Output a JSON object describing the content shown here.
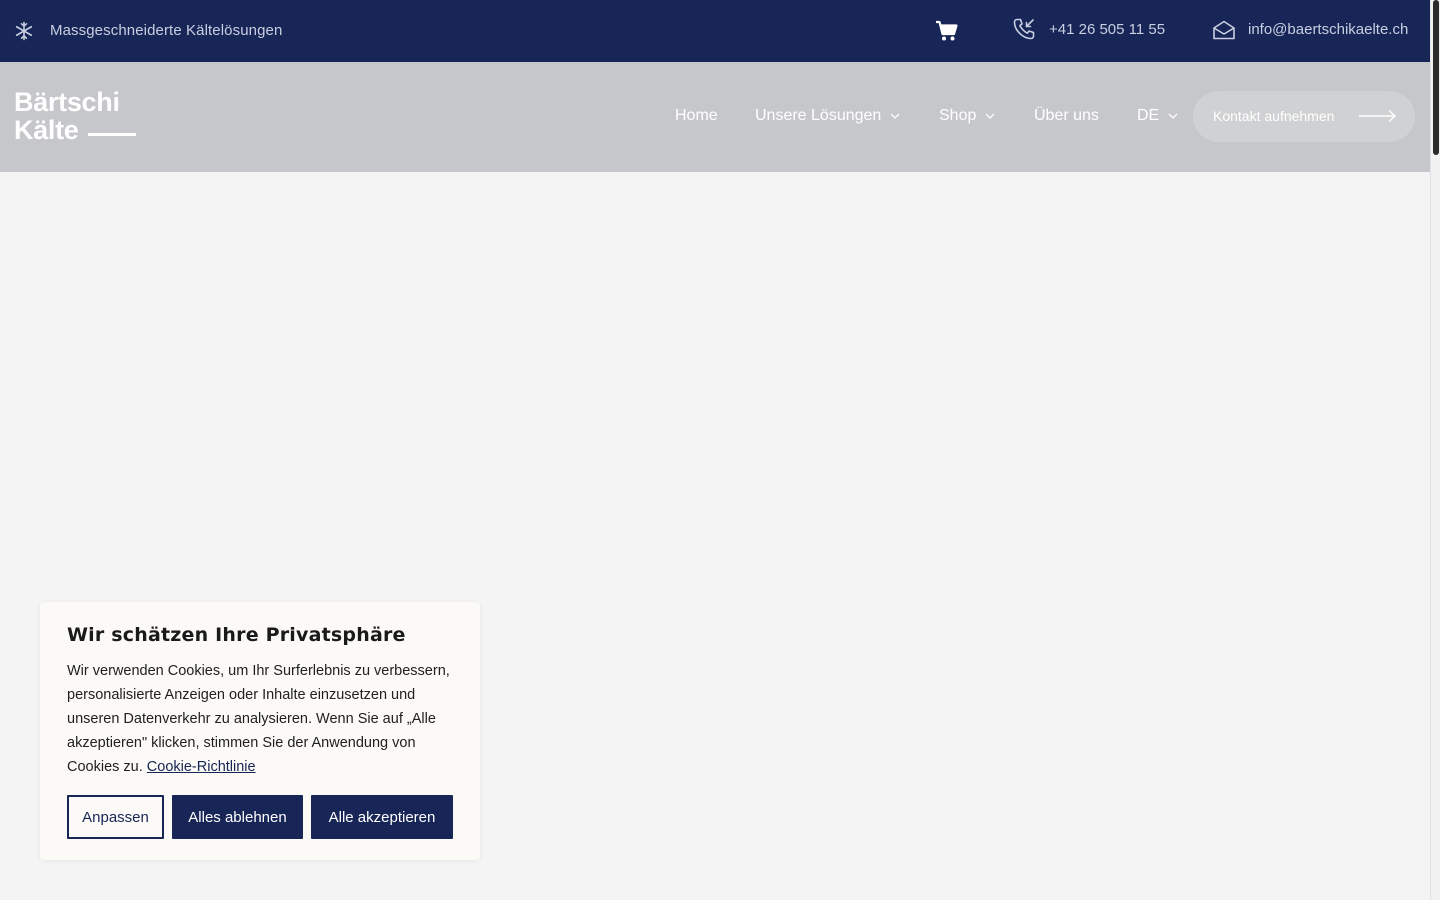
{
  "topbar": {
    "icon": "snowflake-icon",
    "tagline": "Massgeschneiderte Kältelösungen",
    "cart_icon": "cart-icon",
    "phone_icon": "phone-icon",
    "phone": "+41 26 505 11 55",
    "mail_icon": "mail-icon",
    "email": "info@baertschikaelte.ch"
  },
  "header": {
    "logo": {
      "line1": "Bärtschi",
      "line2": "Kälte"
    },
    "nav": {
      "home": "Home",
      "solutions": "Unsere Lösungen",
      "shop": "Shop",
      "about": "Über uns",
      "lang": "DE"
    },
    "cta": "Kontakt aufnehmen"
  },
  "cookie": {
    "title": "Wir schätzen Ihre Privatsphäre",
    "text": "Wir verwenden Cookies, um Ihr Surferlebnis zu verbessern, personalisierte Anzeigen oder Inhalte einzusetzen und unseren Datenverkehr zu analysieren. Wenn Sie auf „Alle akzeptieren\" klicken, stimmen Sie der Anwendung von Cookies zu.",
    "link": "Cookie-Richtlinie",
    "btn_customize": "Anpassen",
    "btn_reject": "Alles ablehnen",
    "btn_accept": "Alle akzeptieren"
  },
  "colors": {
    "navy": "#172557",
    "header_bg": "#c6c7ca",
    "page_bg": "#f4f4f4",
    "cookie_bg": "#fcfaf6"
  }
}
